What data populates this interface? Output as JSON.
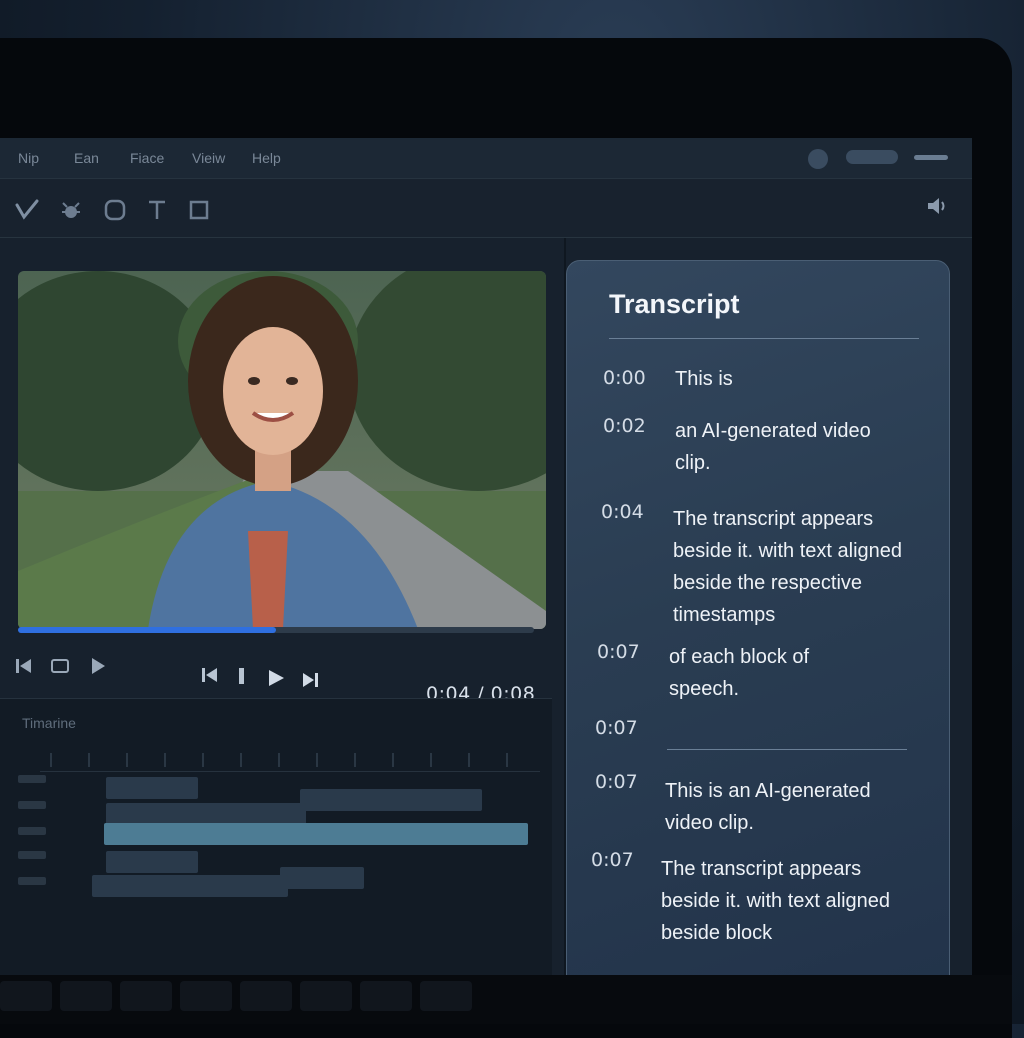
{
  "menu": {
    "items": [
      "Nip",
      "Ean",
      "Fiace",
      "Vieiw",
      "Help"
    ]
  },
  "toolbar": {
    "tools": [
      "pen-icon",
      "bug-icon",
      "shape-icon",
      "text-icon",
      "crop-icon"
    ],
    "volume_icon": "speaker-icon"
  },
  "player": {
    "progress": 0.5,
    "time": "0:04 / 0:08",
    "accent": "#2f6fe0"
  },
  "timeline": {
    "title": "Timarine"
  },
  "transcript": {
    "title": "Transcript",
    "entries": [
      {
        "time": "0:00",
        "text": "This is"
      },
      {
        "time": "0:02",
        "text": "an AI-generated video clip."
      },
      {
        "time": "0:04",
        "text": "The transcript appears beside it. with text aligned beside the respective timestamps"
      },
      {
        "time": "0:07",
        "text": "of each block of speech."
      },
      {
        "time": "0:07",
        "text": ""
      },
      {
        "time": "0:07",
        "text": "This is an AI-generated video clip."
      },
      {
        "time": "0:07",
        "text": "The transcript appears beside it. with text aligned beside block"
      }
    ]
  }
}
